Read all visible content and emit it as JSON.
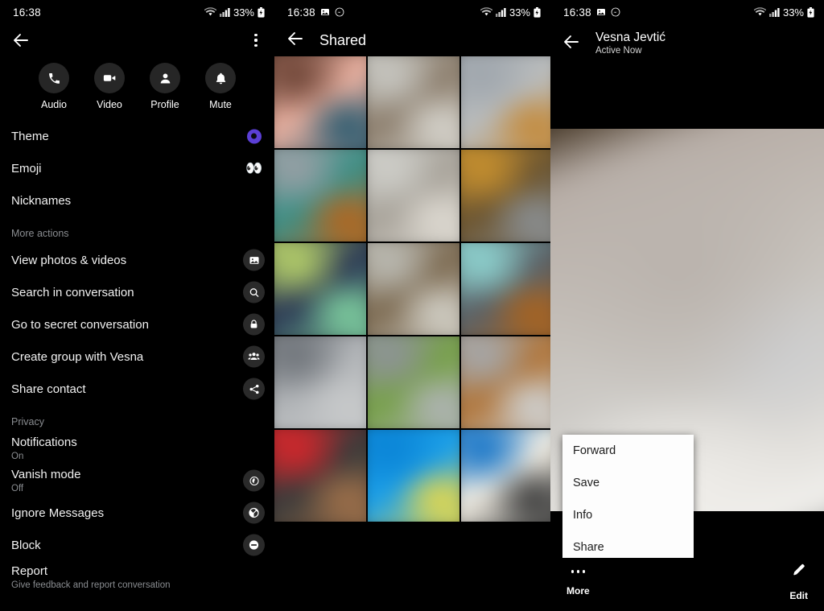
{
  "status_bar": {
    "time": "16:38",
    "battery": "33%",
    "icons": [
      "wifi-icon",
      "cellular-signal-icon",
      "battery-icon"
    ],
    "notification_icons_mid": [
      "image-icon",
      "messenger-icon"
    ]
  },
  "left_panel": {
    "back_icon": "back-arrow-icon",
    "overflow_icon": "kebab-menu-icon",
    "quick_actions": [
      {
        "label": "Audio",
        "icon": "phone-icon"
      },
      {
        "label": "Video",
        "icon": "video-camera-icon"
      },
      {
        "label": "Profile",
        "icon": "person-icon"
      },
      {
        "label": "Mute",
        "icon": "bell-icon"
      }
    ],
    "items": [
      {
        "title": "Theme",
        "sub": "",
        "icon": "theme-color-dot",
        "type": "theme"
      },
      {
        "title": "Emoji",
        "sub": "",
        "icon": "eyes-emoji",
        "type": "emoji",
        "emoji": "👀"
      },
      {
        "title": "Nicknames",
        "sub": "",
        "icon": "",
        "type": "none"
      }
    ],
    "section_more_actions": "More actions",
    "more_actions": [
      {
        "title": "View photos & videos",
        "sub": "",
        "icon": "photo-icon"
      },
      {
        "title": "Search in conversation",
        "sub": "",
        "icon": "search-icon"
      },
      {
        "title": "Go to secret conversation",
        "sub": "",
        "icon": "lock-icon"
      },
      {
        "title": "Create group with Vesna",
        "sub": "",
        "icon": "group-people-icon"
      },
      {
        "title": "Share contact",
        "sub": "",
        "icon": "share-icon"
      }
    ],
    "section_privacy": "Privacy",
    "privacy": [
      {
        "title": "Notifications",
        "sub": "On",
        "icon": ""
      },
      {
        "title": "Vanish mode",
        "sub": "Off",
        "icon": "vanish-mode-icon"
      },
      {
        "title": "Ignore Messages",
        "sub": "",
        "icon": "ignore-messages-icon"
      },
      {
        "title": "Block",
        "sub": "",
        "icon": "block-icon"
      },
      {
        "title": "Report",
        "sub": "Give feedback and report conversation",
        "icon": ""
      }
    ]
  },
  "middle_panel": {
    "back_icon": "back-arrow-icon",
    "title": "Shared",
    "grid": [
      {
        "name": "photo-child-pink",
        "c1": "#6b4234",
        "c2": "#e8b0a0",
        "c3": "#2b5b70"
      },
      {
        "name": "photo-paper-gray",
        "c1": "#c9c9c4",
        "c2": "#8d7f6e",
        "c3": "#d6d4cd"
      },
      {
        "name": "photo-concrete",
        "c1": "#9fa6ad",
        "c2": "#b9bcbd",
        "c3": "#c48a3a"
      },
      {
        "name": "photo-pavement",
        "c1": "#9aa0a6",
        "c2": "#3e8f86",
        "c3": "#b5651d"
      },
      {
        "name": "photo-paper-white",
        "c1": "#cfcfca",
        "c2": "#a8a39a",
        "c3": "#dedad2"
      },
      {
        "name": "photo-wood-table",
        "c1": "#c8912f",
        "c2": "#6c5530",
        "c3": "#8a8f93"
      },
      {
        "name": "photo-fabric-green",
        "c1": "#b9d36a",
        "c2": "#2c3a55",
        "c3": "#7fd0a0"
      },
      {
        "name": "photo-stone-path",
        "c1": "#bdbdb6",
        "c2": "#7d6b52",
        "c3": "#d3d1c8"
      },
      {
        "name": "photo-teal-wall",
        "c1": "#8fd5d2",
        "c2": "#5a6268",
        "c3": "#a9631f"
      },
      {
        "name": "photo-floor-gray",
        "c1": "#6e7379",
        "c2": "#b2b5b8",
        "c3": "#c8cacb"
      },
      {
        "name": "photo-sidewalk",
        "c1": "#8e9398",
        "c2": "#77a04a",
        "c3": "#b0b4b6"
      },
      {
        "name": "photo-pool-edge",
        "c1": "#a5a9ad",
        "c2": "#b0763c",
        "c3": "#cfd2d3"
      },
      {
        "name": "photo-coke-cup",
        "c1": "#d7262b",
        "c2": "#3a3a3a",
        "c3": "#a0714a"
      },
      {
        "name": "photo-blue-water",
        "c1": "#0a84d6",
        "c2": "#1c9fe8",
        "c3": "#e8d94a"
      },
      {
        "name": "photo-blue-chair",
        "c1": "#1273c8",
        "c2": "#f0ece2",
        "c3": "#3a3a3a"
      }
    ]
  },
  "right_panel": {
    "back_icon": "back-arrow-icon",
    "contact_name": "Vesna Jevtić",
    "presence": "Active Now",
    "photo_name": "shared-photo-preview",
    "context_menu": [
      {
        "label": "Forward"
      },
      {
        "label": "Save"
      },
      {
        "label": "Info"
      },
      {
        "label": "Share"
      }
    ],
    "bottom_bar": [
      {
        "label": "More",
        "icon": "more-dots-icon"
      },
      {
        "label": "Edit",
        "icon": "pencil-icon"
      }
    ]
  },
  "colors": {
    "background": "#000000",
    "text_primary": "#f2f2f2",
    "text_secondary": "#8a8d91",
    "icon_bubble": "#2a2a2a",
    "theme_accent": "#5b3fd6",
    "menu_surface": "#fdfdfd"
  }
}
